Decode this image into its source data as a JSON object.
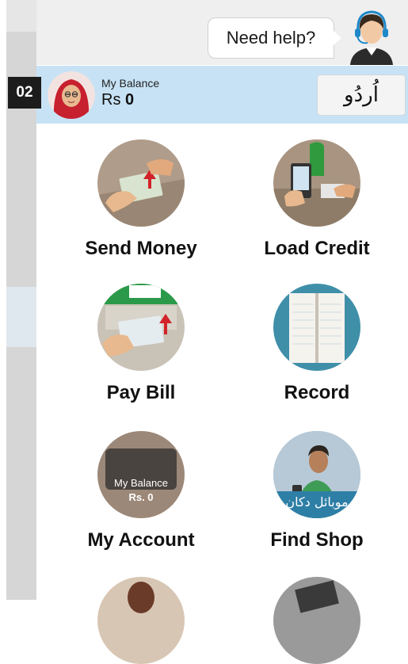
{
  "header": {
    "help_text": "Need help?"
  },
  "balance": {
    "badge": "02",
    "label": "My Balance",
    "currency": "Rs",
    "amount": "0",
    "language_button": "اُردُو"
  },
  "menu": [
    {
      "label": "Send Money",
      "icon": "send-money-icon"
    },
    {
      "label": "Load Credit",
      "icon": "load-credit-icon"
    },
    {
      "label": "Pay Bill",
      "icon": "pay-bill-icon"
    },
    {
      "label": "Record",
      "icon": "record-icon"
    },
    {
      "label": "My Account",
      "icon": "wallet-icon",
      "icon_text_1": "My Balance",
      "icon_text_2": "Rs. 0"
    },
    {
      "label": "Find Shop",
      "icon": "shopkeeper-icon",
      "icon_text": "موبائل دکان"
    }
  ],
  "colors": {
    "balance_bar": "#c7e2f5",
    "topbar": "#efefef",
    "badge": "#1c1c1c"
  }
}
